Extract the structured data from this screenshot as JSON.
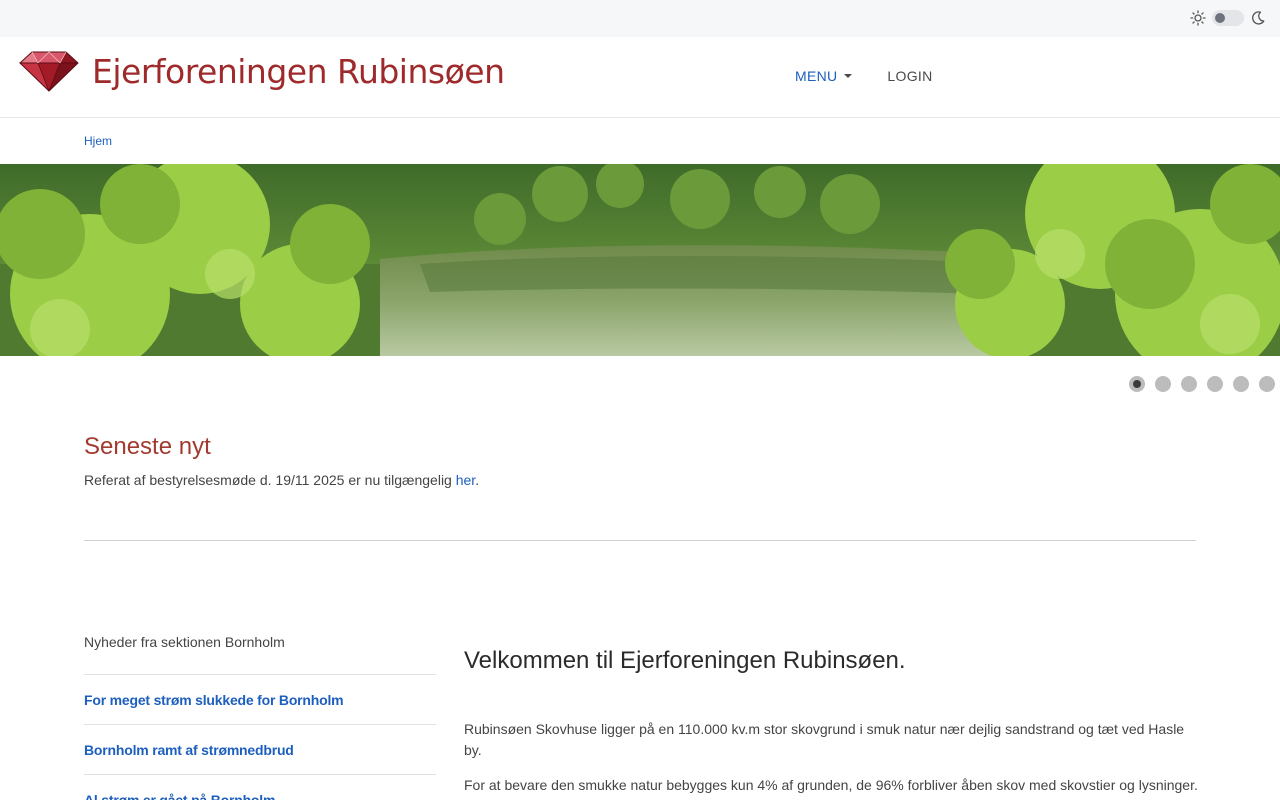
{
  "topbar": {
    "sun_icon": "sun-icon",
    "moon_icon": "moon-icon"
  },
  "header": {
    "logo_text": "Ejerforeningen Rubinsøen",
    "logo_icon": "ruby-gem-icon"
  },
  "nav": {
    "menu_label": "MENU",
    "login_label": "LOGIN"
  },
  "breadcrumb": {
    "home": "Hjem"
  },
  "carousel": {
    "slide_count": 6,
    "active_index": 0
  },
  "news": {
    "title": "Seneste nyt",
    "text": "Referat af bestyrelsesmøde d. 19/11 2025 er nu tilgængelig ",
    "link": "her",
    "suffix": "."
  },
  "sidebar": {
    "heading": "Nyheder fra sektionen Bornholm",
    "items": [
      {
        "label": "For meget strøm slukkede for Bornholm"
      },
      {
        "label": "Bornholm ramt af strømnedbrud"
      },
      {
        "label": "Al strøm er gået på Bornholm"
      }
    ]
  },
  "main": {
    "welcome": "Velkommen til Ejerforeningen Rubinsøen.",
    "para1": "Rubinsøen Skovhuse ligger på en 110.000 kv.m stor skovgrund i smuk natur nær dejlig sandstrand og tæt ved Hasle by.",
    "para2": "For at bevare den smukke natur bebygges kun 4% af grunden, de 96% forbliver åben skov med skovstier og lysninger."
  },
  "colors": {
    "accent_blue": "#1d5fbf",
    "brand_red": "#9e2a2b",
    "heading_red": "#a33a2f"
  }
}
